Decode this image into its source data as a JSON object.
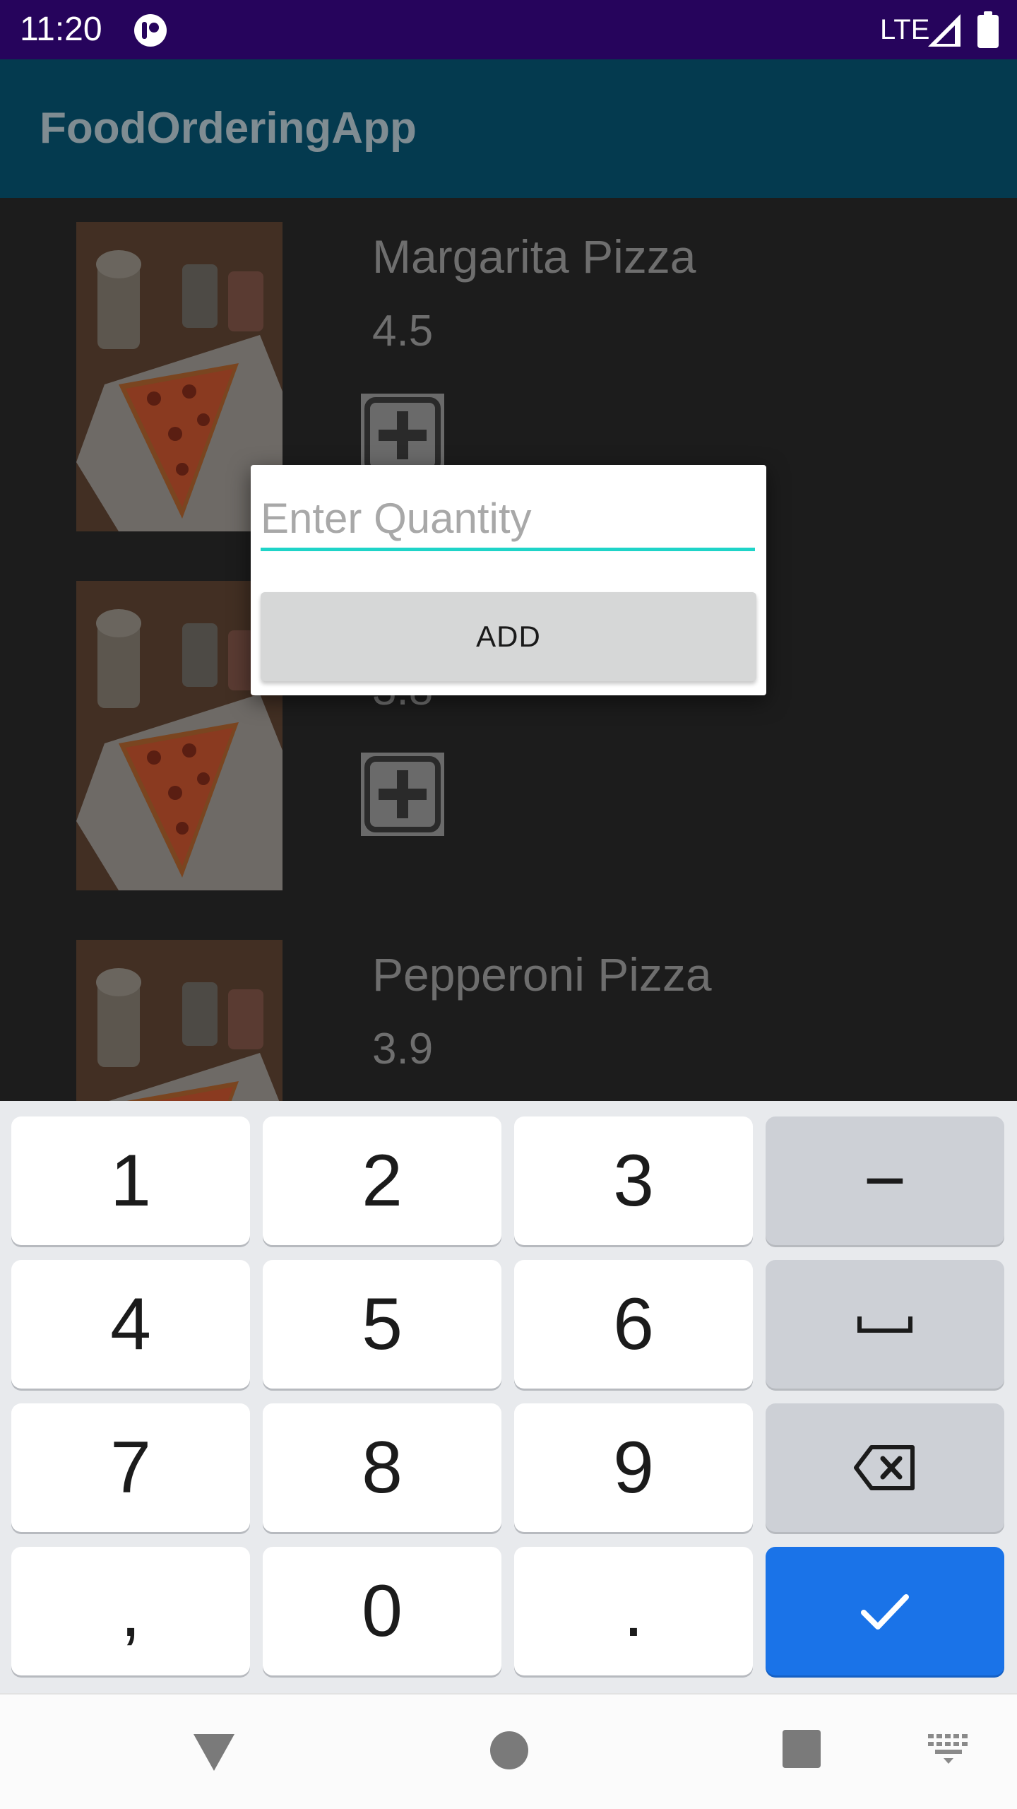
{
  "status_bar": {
    "time": "11:20",
    "network": "LTE",
    "icons": [
      "app-notification-icon",
      "signal-icon",
      "battery-icon"
    ]
  },
  "app_bar": {
    "title": "FoodOrderingApp"
  },
  "menu": {
    "items": [
      {
        "name": "Margarita Pizza",
        "rating": "4.5",
        "image": "pizza-photo"
      },
      {
        "name": "",
        "rating": "3.8",
        "image": "pizza-photo"
      },
      {
        "name": "Pepperoni  Pizza",
        "rating": "3.9",
        "image": "pizza-photo"
      }
    ],
    "add_icon": "plus-icon"
  },
  "dialog": {
    "quantity_placeholder": "Enter Quantity",
    "quantity_value": "",
    "add_label": "ADD",
    "accent_color": "#1fd4c8"
  },
  "keyboard": {
    "rows": [
      [
        "1",
        "2",
        "3",
        "−"
      ],
      [
        "4",
        "5",
        "6",
        "space-icon"
      ],
      [
        "7",
        "8",
        "9",
        "backspace-icon"
      ],
      [
        ",",
        "0",
        ".",
        "checkmark-icon"
      ]
    ],
    "enter_color": "#1a73e8"
  },
  "nav_bar": {
    "icons": [
      "back-icon",
      "home-icon",
      "recents-icon",
      "keyboard-switch-icon"
    ]
  }
}
